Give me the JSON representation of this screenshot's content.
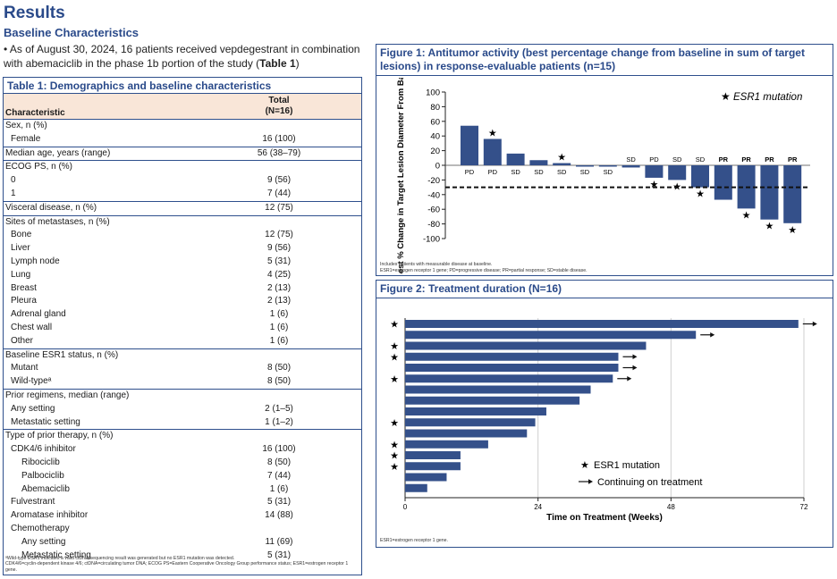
{
  "header": {
    "results_title": "Results",
    "baseline_heading": "Baseline Characteristics",
    "bullet_pre": "As of August 30, 2024, 16 patients received vepdegestrant in combination with abemaciclib in the phase 1b portion of the study (",
    "bullet_bold": "Table 1",
    "bullet_post": ")"
  },
  "table1": {
    "title": "Table 1: Demographics and baseline characteristics",
    "col_characteristic": "Characteristic",
    "col_total_line1": "Total",
    "col_total_line2": "(N=16)",
    "rows": [
      {
        "label": "Sex, n (%)",
        "value": "",
        "indent": 0,
        "section": true
      },
      {
        "label": "Female",
        "value": "16 (100)",
        "indent": 1
      },
      {
        "label": "Median age, years (range)",
        "value": "56 (38–79)",
        "indent": 0,
        "section": true
      },
      {
        "label": "ECOG PS, n (%)",
        "value": "",
        "indent": 0,
        "section": true
      },
      {
        "label": "0",
        "value": "9 (56)",
        "indent": 1
      },
      {
        "label": "1",
        "value": "7 (44)",
        "indent": 1
      },
      {
        "label": "Visceral disease, n (%)",
        "value": "12 (75)",
        "indent": 0,
        "section": true
      },
      {
        "label": "Sites of metastases, n (%)",
        "value": "",
        "indent": 0,
        "section": true
      },
      {
        "label": "Bone",
        "value": "12 (75)",
        "indent": 1
      },
      {
        "label": "Liver",
        "value": "9 (56)",
        "indent": 1
      },
      {
        "label": "Lymph node",
        "value": "5 (31)",
        "indent": 1
      },
      {
        "label": "Lung",
        "value": "4 (25)",
        "indent": 1
      },
      {
        "label": "Breast",
        "value": "2 (13)",
        "indent": 1
      },
      {
        "label": "Pleura",
        "value": "2 (13)",
        "indent": 1
      },
      {
        "label": "Adrenal gland",
        "value": "1 (6)",
        "indent": 1
      },
      {
        "label": "Chest wall",
        "value": "1 (6)",
        "indent": 1
      },
      {
        "label": "Other",
        "value": "1 (6)",
        "indent": 1
      },
      {
        "label": "Baseline ESR1 status, n (%)",
        "value": "",
        "indent": 0,
        "section": true
      },
      {
        "label": "Mutant",
        "value": "8 (50)",
        "indent": 1
      },
      {
        "label": "Wild-typeᵃ",
        "value": "8 (50)",
        "indent": 1
      },
      {
        "label": "Prior regimens, median (range)",
        "value": "",
        "indent": 0,
        "section": true
      },
      {
        "label": "Any setting",
        "value": "2 (1–5)",
        "indent": 1
      },
      {
        "label": "Metastatic setting",
        "value": "1 (1–2)",
        "indent": 1
      },
      {
        "label": "Type of prior therapy, n (%)",
        "value": "",
        "indent": 0,
        "section": true
      },
      {
        "label": "CDK4/6 inhibitor",
        "value": "16 (100)",
        "indent": 1
      },
      {
        "label": "Ribociclib",
        "value": "8 (50)",
        "indent": 2
      },
      {
        "label": "Palbociclib",
        "value": "7 (44)",
        "indent": 2
      },
      {
        "label": "Abemaciclib",
        "value": "1 (6)",
        "indent": 2
      },
      {
        "label": "Fulvestrant",
        "value": "5 (31)",
        "indent": 1
      },
      {
        "label": "Aromatase inhibitor",
        "value": "14 (88)",
        "indent": 1
      },
      {
        "label": "Chemotherapy",
        "value": "",
        "indent": 1
      },
      {
        "label": "Any setting",
        "value": "11 (69)",
        "indent": 2
      },
      {
        "label": "Metastatic setting",
        "value": "5 (31)",
        "indent": 2
      }
    ],
    "footnote_1": "ᵃWild-type ESR1 indicates a valid ctDNA sequencing result was generated but no ESR1 mutation was detected.",
    "footnote_2": "CDK4/6=cyclin-dependent kinase 4/6; ctDNA=circulating tumor DNA; ECOG PS=Eastern Cooperative Oncology Group performance status; ESR1=estrogen receptor 1 gene."
  },
  "figure1": {
    "title": "Figure 1: Antitumor activity (best percentage change from baseline in sum of target lesions) in response-evaluable patients (n=15)",
    "legend": "ESR1 mutation",
    "footnote_1": "Includes patients with measurable disease at baseline.",
    "footnote_2": "ESR1=estrogen receptor 1 gene; PD=progressive disease; PR=partial response; SD=stable disease."
  },
  "figure2": {
    "title": "Figure 2: Treatment duration (N=16)",
    "legend_star": "ESR1 mutation",
    "legend_arrow": "Continuing on treatment",
    "footnote": "ESR1=estrogen receptor 1 gene."
  },
  "chart_data": [
    {
      "type": "bar",
      "title": "",
      "ylabel": "Best % Change in Target Lesion Diameter From Baseline",
      "xlabel": "",
      "ylim": [
        -100,
        100
      ],
      "yticks": [
        100,
        80,
        60,
        40,
        20,
        0,
        -20,
        -40,
        -60,
        -80,
        -100
      ],
      "reference_line": -30,
      "grid": false,
      "legend_position": "top-right",
      "colors": {
        "bar": "#34508a"
      },
      "bars": [
        {
          "value": 54,
          "response": "PD",
          "esr1": false
        },
        {
          "value": 36,
          "response": "PD",
          "esr1": true
        },
        {
          "value": 16,
          "response": "SD",
          "esr1": false
        },
        {
          "value": 7,
          "response": "SD",
          "esr1": false
        },
        {
          "value": 3,
          "response": "SD",
          "esr1": true
        },
        {
          "value": 0,
          "response": "SD",
          "esr1": false
        },
        {
          "value": 0,
          "response": "SD",
          "esr1": false
        },
        {
          "value": -3,
          "response": "SD",
          "esr1": false
        },
        {
          "value": -17,
          "response": "PD",
          "esr1": true
        },
        {
          "value": -20,
          "response": "SD",
          "esr1": true
        },
        {
          "value": -30,
          "response": "SD",
          "esr1": true
        },
        {
          "value": -47,
          "response": "PR",
          "esr1": false
        },
        {
          "value": -59,
          "response": "PR",
          "esr1": true
        },
        {
          "value": -74,
          "response": "PR",
          "esr1": true
        },
        {
          "value": -79,
          "response": "PR",
          "esr1": true
        }
      ]
    },
    {
      "type": "bar",
      "orientation": "horizontal",
      "title": "",
      "xlabel": "Time on Treatment (Weeks)",
      "ylabel": "",
      "xlim": [
        0,
        72
      ],
      "xticks": [
        0,
        24,
        48,
        72
      ],
      "grid": true,
      "legend_position": "bottom-right",
      "colors": {
        "bar": "#34508a"
      },
      "bars": [
        {
          "weeks": 71,
          "esr1": true,
          "continuing": true
        },
        {
          "weeks": 52.5,
          "esr1": false,
          "continuing": true
        },
        {
          "weeks": 43.5,
          "esr1": true,
          "continuing": false
        },
        {
          "weeks": 38.5,
          "esr1": true,
          "continuing": true
        },
        {
          "weeks": 38.5,
          "esr1": false,
          "continuing": true
        },
        {
          "weeks": 37.5,
          "esr1": true,
          "continuing": true
        },
        {
          "weeks": 33.5,
          "esr1": false,
          "continuing": false
        },
        {
          "weeks": 31.5,
          "esr1": false,
          "continuing": false
        },
        {
          "weeks": 25.5,
          "esr1": false,
          "continuing": false
        },
        {
          "weeks": 23.5,
          "esr1": true,
          "continuing": false
        },
        {
          "weeks": 22,
          "esr1": false,
          "continuing": false
        },
        {
          "weeks": 15,
          "esr1": true,
          "continuing": false
        },
        {
          "weeks": 10,
          "esr1": true,
          "continuing": false
        },
        {
          "weeks": 10,
          "esr1": true,
          "continuing": false
        },
        {
          "weeks": 7.5,
          "esr1": false,
          "continuing": false
        },
        {
          "weeks": 4,
          "esr1": false,
          "continuing": false
        }
      ]
    }
  ]
}
